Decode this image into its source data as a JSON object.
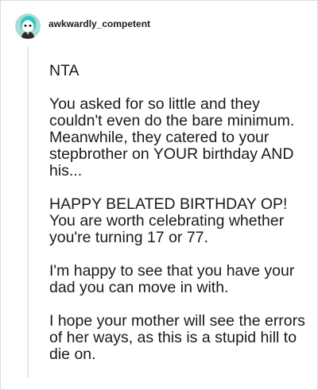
{
  "comment": {
    "author": "awkwardly_competent",
    "paragraphs": [
      "NTA",
      "You asked for so little and they couldn't even do the bare minimum. Meanwhile, they catered to your stepbrother on YOUR birthday AND his...",
      "HAPPY BELATED BIRTHDAY OP! You are worth celebrating whether you're turning 17 or 77.",
      "I'm happy to see that you have your dad you can move in with.",
      "I hope your mother will see the errors of her ways, as this is a stupid hill to die on."
    ]
  },
  "colors": {
    "avatar_bg": "#a9ddd8",
    "avatar_hair": "#39c7c4",
    "text": "#1a1a1b",
    "thread_line": "#e6e6e6"
  },
  "icons": {
    "avatar": "user-avatar-icon"
  }
}
